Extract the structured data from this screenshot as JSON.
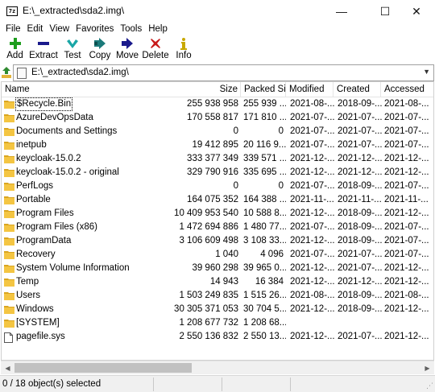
{
  "window": {
    "app_icon_text": "7z",
    "title": "E:\\_extracted\\sda2.img\\",
    "minimize": "—",
    "maximize": "☐",
    "close": "✕"
  },
  "menu": [
    "File",
    "Edit",
    "View",
    "Favorites",
    "Tools",
    "Help"
  ],
  "toolbar": [
    {
      "label": "Add",
      "icon": "plus-icon",
      "color": "#1e9e1e"
    },
    {
      "label": "Extract",
      "icon": "minus-icon",
      "color": "#1a1a8c"
    },
    {
      "label": "Test",
      "icon": "check-icon",
      "color": "#1aa6a6"
    },
    {
      "label": "Copy",
      "icon": "double-arrow-right-icon",
      "color": "#1b7a7a"
    },
    {
      "label": "Move",
      "icon": "arrow-right-icon",
      "color": "#1a1a8c"
    },
    {
      "label": "Delete",
      "icon": "x-icon",
      "color": "#c81a1a"
    },
    {
      "label": "Info",
      "icon": "info-icon",
      "color": "#c8a800"
    }
  ],
  "address": {
    "path": "E:\\_extracted\\sda2.img\\"
  },
  "columns": [
    "Name",
    "Size",
    "Packed Si...",
    "Modified",
    "Created",
    "Accessed"
  ],
  "rows": [
    {
      "name": "$Recycle.Bin",
      "type": "folder",
      "size": "255 938 958",
      "packed": "255 939 ...",
      "modified": "2021-08-...",
      "created": "2018-09-...",
      "accessed": "2021-08-..."
    },
    {
      "name": "AzureDevOpsData",
      "type": "folder",
      "size": "170 558 817",
      "packed": "171 810 ...",
      "modified": "2021-07-...",
      "created": "2021-07-...",
      "accessed": "2021-07-..."
    },
    {
      "name": "Documents and Settings",
      "type": "folder",
      "size": "0",
      "packed": "0",
      "modified": "2021-07-...",
      "created": "2021-07-...",
      "accessed": "2021-07-..."
    },
    {
      "name": "inetpub",
      "type": "folder",
      "size": "19 412 895",
      "packed": "20 116 9...",
      "modified": "2021-07-...",
      "created": "2021-07-...",
      "accessed": "2021-07-..."
    },
    {
      "name": "keycloak-15.0.2",
      "type": "folder",
      "size": "333 377 349",
      "packed": "339 571 ...",
      "modified": "2021-12-...",
      "created": "2021-12-...",
      "accessed": "2021-12-..."
    },
    {
      "name": "keycloak-15.0.2 - original",
      "type": "folder",
      "size": "329 790 916",
      "packed": "335 695 ...",
      "modified": "2021-12-...",
      "created": "2021-12-...",
      "accessed": "2021-12-..."
    },
    {
      "name": "PerfLogs",
      "type": "folder",
      "size": "0",
      "packed": "0",
      "modified": "2021-07-...",
      "created": "2018-09-...",
      "accessed": "2021-07-..."
    },
    {
      "name": "Portable",
      "type": "folder",
      "size": "164 075 352",
      "packed": "164 388 ...",
      "modified": "2021-11-...",
      "created": "2021-11-...",
      "accessed": "2021-11-..."
    },
    {
      "name": "Program Files",
      "type": "folder",
      "size": "10 409 953 540",
      "packed": "10 588 8...",
      "modified": "2021-12-...",
      "created": "2018-09-...",
      "accessed": "2021-12-..."
    },
    {
      "name": "Program Files (x86)",
      "type": "folder",
      "size": "1 472 694 886",
      "packed": "1 480 77...",
      "modified": "2021-07-...",
      "created": "2018-09-...",
      "accessed": "2021-07-..."
    },
    {
      "name": "ProgramData",
      "type": "folder",
      "size": "3 106 609 498",
      "packed": "3 108 33...",
      "modified": "2021-12-...",
      "created": "2018-09-...",
      "accessed": "2021-07-..."
    },
    {
      "name": "Recovery",
      "type": "folder",
      "size": "1 040",
      "packed": "4 096",
      "modified": "2021-07-...",
      "created": "2021-07-...",
      "accessed": "2021-07-..."
    },
    {
      "name": "System Volume Information",
      "type": "folder",
      "size": "39 960 298",
      "packed": "39 965 0...",
      "modified": "2021-12-...",
      "created": "2021-07-...",
      "accessed": "2021-12-..."
    },
    {
      "name": "Temp",
      "type": "folder",
      "size": "14 943",
      "packed": "16 384",
      "modified": "2021-12-...",
      "created": "2021-12-...",
      "accessed": "2021-12-..."
    },
    {
      "name": "Users",
      "type": "folder",
      "size": "1 503 249 835",
      "packed": "1 515 26...",
      "modified": "2021-08-...",
      "created": "2018-09-...",
      "accessed": "2021-08-..."
    },
    {
      "name": "Windows",
      "type": "folder",
      "size": "30 305 371 053",
      "packed": "30 704 5...",
      "modified": "2021-12-...",
      "created": "2018-09-...",
      "accessed": "2021-12-..."
    },
    {
      "name": "[SYSTEM]",
      "type": "folder",
      "size": "1 208 677 732",
      "packed": "1 208 68...",
      "modified": "",
      "created": "",
      "accessed": ""
    },
    {
      "name": "pagefile.sys",
      "type": "file",
      "size": "2 550 136 832",
      "packed": "2 550 13...",
      "modified": "2021-12-...",
      "created": "2021-07-...",
      "accessed": "2021-12-..."
    }
  ],
  "status": {
    "selection": "0 / 18 object(s) selected"
  },
  "colors": {
    "folder": "#f4c542",
    "folder_dark": "#d9a520"
  }
}
